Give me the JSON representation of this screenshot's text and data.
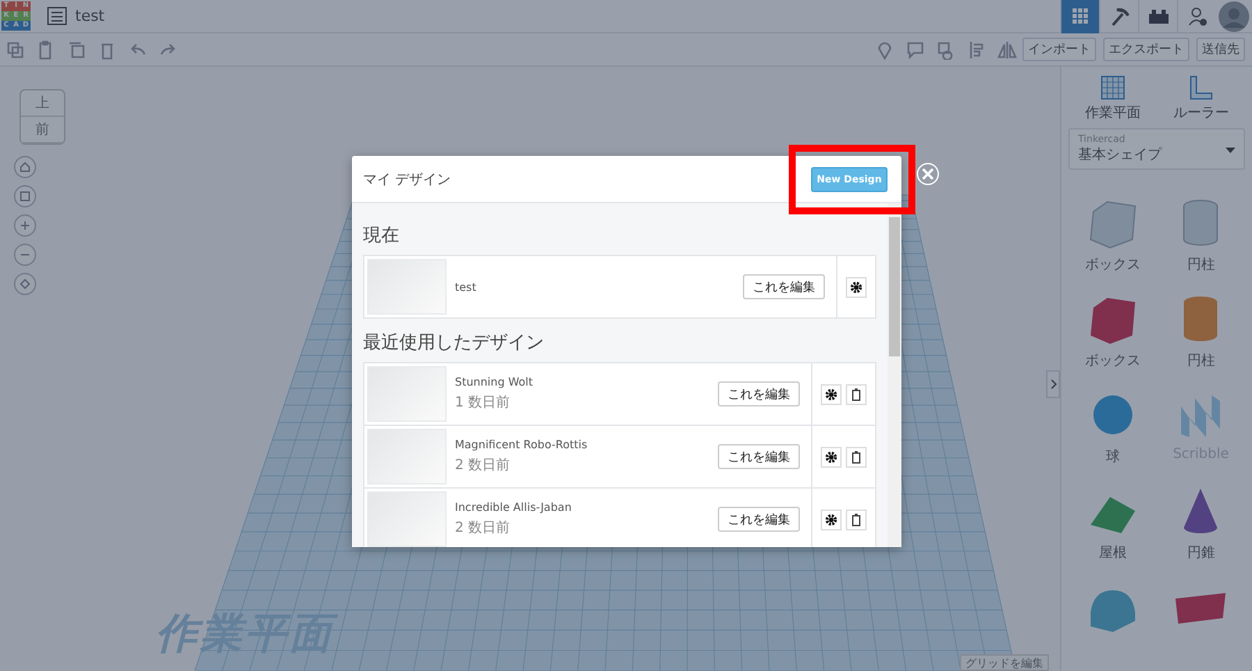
{
  "logo_letters": [
    "T",
    "I",
    "N",
    "K",
    "E",
    "R",
    "C",
    "A",
    "D"
  ],
  "title": "test",
  "top_nav": [
    {
      "kind": "grid",
      "selected": true
    },
    {
      "kind": "pickaxe",
      "selected": false
    },
    {
      "kind": "brick",
      "selected": false
    },
    {
      "kind": "user-add",
      "selected": false
    }
  ],
  "toolbar_actions": [
    "インポート",
    "エクスポート",
    "送信先"
  ],
  "view_cube": {
    "top": "上",
    "front": "前"
  },
  "right_panel": {
    "tools": [
      {
        "kind": "workplane",
        "label": "作業平面"
      },
      {
        "kind": "ruler",
        "label": "ルーラー"
      }
    ],
    "library": {
      "source": "Tinkercad",
      "category": "基本シェイプ"
    },
    "shapes": [
      {
        "kind": "box_hole",
        "label": "ボックス"
      },
      {
        "kind": "cylinder_hole",
        "label": "円柱"
      },
      {
        "kind": "box",
        "label": "ボックス"
      },
      {
        "kind": "cylinder",
        "label": "円柱"
      },
      {
        "kind": "sphere",
        "label": "球"
      },
      {
        "kind": "scribble",
        "label": "Scribble"
      },
      {
        "kind": "roof",
        "label": "屋根"
      },
      {
        "kind": "cone",
        "label": "円錐"
      },
      {
        "kind": "round_roof"
      },
      {
        "kind": "text"
      }
    ]
  },
  "workplane": {
    "label": "作業平面",
    "edit_grid": "グリッドを編集"
  },
  "dialog": {
    "title": "マイ デザイン",
    "new_button": "New Design",
    "current_heading": "現在",
    "current": {
      "name": "test",
      "edit": "これを編集"
    },
    "recent_heading": "最近使用したデザイン",
    "recent": [
      {
        "name": "Stunning Wolt",
        "time": "1 数日前",
        "edit": "これを編集"
      },
      {
        "name": "Magnificent Robo-Rottis",
        "time": "2 数日前",
        "edit": "これを編集"
      },
      {
        "name": "Incredible Allis-Jaban",
        "time": "2 数日前",
        "edit": "これを編集"
      }
    ]
  }
}
